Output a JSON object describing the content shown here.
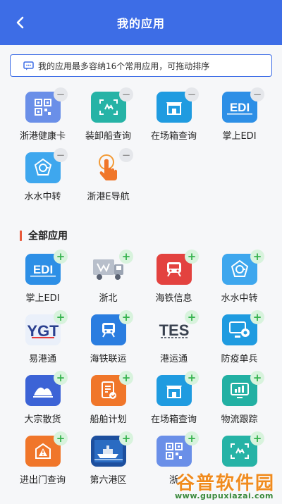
{
  "header": {
    "title": "我的应用"
  },
  "notice": {
    "text": "我的应用最多容纳16个常用应用，可拖动排序"
  },
  "my_apps": [
    {
      "label": "浙港健康卡",
      "icon": "qr-code-icon"
    },
    {
      "label": "装卸船查询",
      "icon": "crane-scan-icon"
    },
    {
      "label": "在场箱查询",
      "icon": "container-yard-icon"
    },
    {
      "label": "掌上EDI",
      "icon": "edi-icon"
    },
    {
      "label": "水水中转",
      "icon": "water-transfer-icon"
    },
    {
      "label": "浙港E导航",
      "icon": "touch-navigation-icon"
    }
  ],
  "all_apps": {
    "title": "全部应用",
    "items": [
      {
        "label": "掌上EDI",
        "icon": "edi-icon"
      },
      {
        "label": "浙北",
        "icon": "truck-icon"
      },
      {
        "label": "海铁信息",
        "icon": "train-red-icon"
      },
      {
        "label": "水水中转",
        "icon": "water-transfer-icon"
      },
      {
        "label": "易港通",
        "icon": "ygt-logo-icon"
      },
      {
        "label": "海铁联运",
        "icon": "train-blue-icon"
      },
      {
        "label": "港运通",
        "icon": "tes-logo-icon"
      },
      {
        "label": "防疫单兵",
        "icon": "monitor-camera-icon"
      },
      {
        "label": "大宗散货",
        "icon": "bulk-cargo-icon"
      },
      {
        "label": "船舶计划",
        "icon": "ship-plan-icon"
      },
      {
        "label": "在场箱查询",
        "icon": "container-yard-icon"
      },
      {
        "label": "物流跟踪",
        "icon": "logistics-chart-icon"
      },
      {
        "label": "进出门查询",
        "icon": "gate-warning-icon"
      },
      {
        "label": "第六港区",
        "icon": "port-ship-icon"
      },
      {
        "label": "浙",
        "icon": "qr-code-icon"
      },
      {
        "label": "",
        "icon": "crane-scan-icon"
      }
    ]
  },
  "watermark": {
    "main": "谷普软件园",
    "url": "www.gupuxiazai.com"
  },
  "colors": {
    "header": "#3d6de6",
    "accent_bar": "#e8593a",
    "plus": "#35b24d"
  }
}
